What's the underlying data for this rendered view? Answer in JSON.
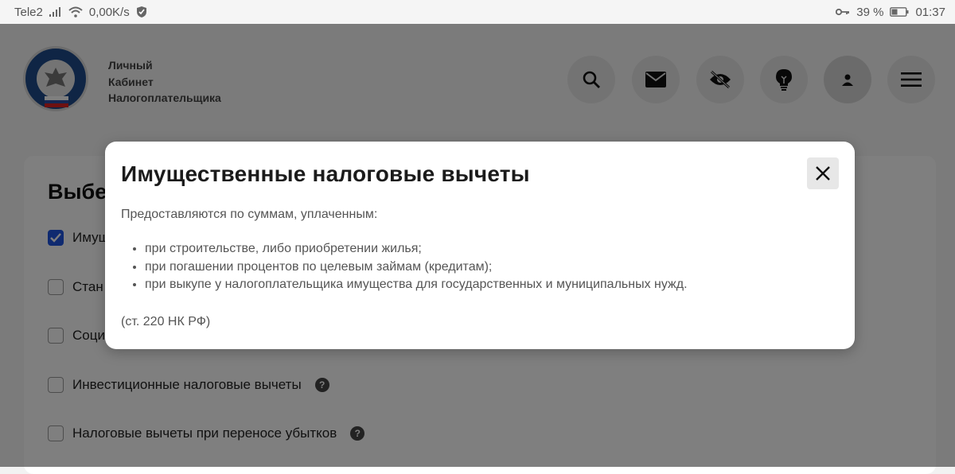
{
  "statusbar": {
    "carrier": "Tele2",
    "speed": "0,00K/s",
    "battery": "39 %",
    "time": "01:37"
  },
  "header": {
    "brand_line1": "Личный",
    "brand_line2": "Кабинет",
    "brand_line3": "Налогоплательщика",
    "buttons": [
      "search-icon",
      "mail-icon",
      "eye-off-icon",
      "lightbulb-icon",
      "user-icon",
      "menu-icon"
    ]
  },
  "background_card": {
    "title_visible": "Выбер",
    "options": [
      {
        "label": "Имущ",
        "checked": true
      },
      {
        "label": "Стан",
        "checked": false
      },
      {
        "label": "Соци",
        "checked": false
      },
      {
        "label": "Инвестиционные налоговые вычеты",
        "checked": false,
        "help": "?"
      },
      {
        "label": "Налоговые вычеты при переносе убытков",
        "checked": false,
        "help": "?"
      }
    ]
  },
  "modal": {
    "title": "Имущественные налоговые вычеты",
    "intro": "Предоставляются по суммам, уплаченным:",
    "items": [
      "при строительстве, либо приобретении жилья;",
      "при погашении процентов по целевым займам (кредитам);",
      "при выкупе у налогоплательщика имущества для государственных и муниципальных нужд."
    ],
    "footnote": "(ст. 220 НК РФ)"
  },
  "colors": {
    "accent": "#1f55e0",
    "overlay": "rgba(0,0,0,0.5)"
  }
}
